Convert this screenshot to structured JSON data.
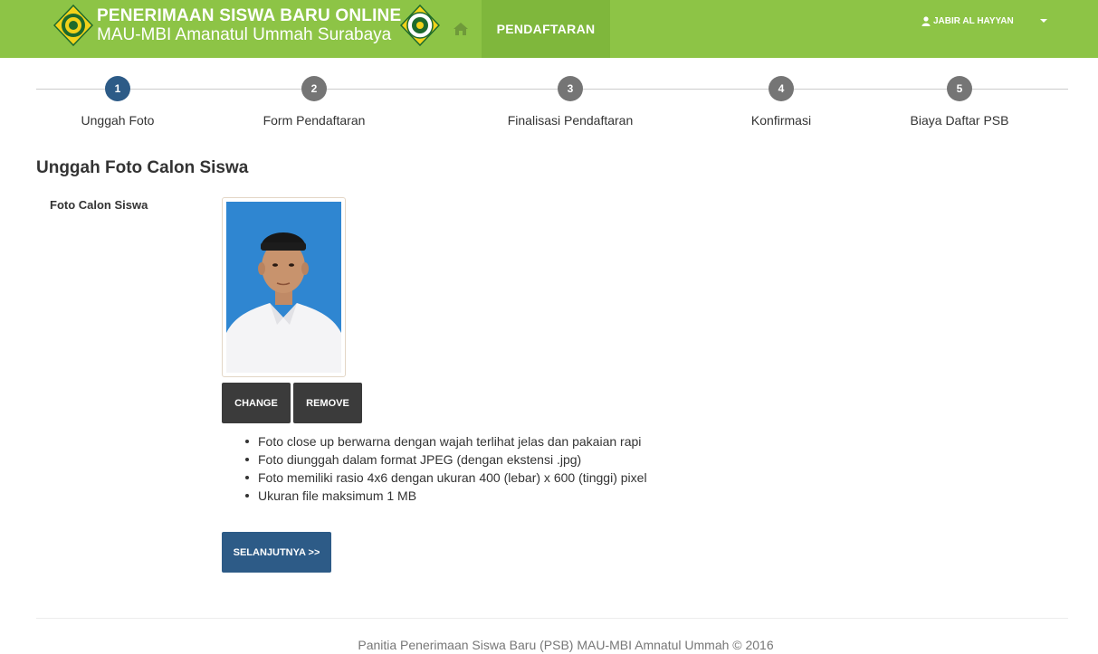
{
  "header": {
    "title": "PENERIMAAN SISWA BARU ONLINE",
    "subtitle": "MAU-MBI Amanatul Ummah Surabaya",
    "home_icon": "home-icon",
    "nav_active": "PENDAFTARAN",
    "user_name": "JABIR AL HAYYAN",
    "colors": {
      "bar": "#8dc446",
      "active": "#7fb73c"
    }
  },
  "wizard": {
    "steps": [
      {
        "number": "1",
        "label": "Unggah Foto",
        "active": true
      },
      {
        "number": "2",
        "label": "Form Pendaftaran",
        "active": false
      },
      {
        "number": "3",
        "label": "Finalisasi Pendaftaran",
        "active": false
      },
      {
        "number": "4",
        "label": "Konfirmasi",
        "active": false
      },
      {
        "number": "5",
        "label": "Biaya Daftar PSB",
        "active": false
      }
    ],
    "colors": {
      "active": "#2d5b87",
      "inactive": "#757575"
    }
  },
  "content": {
    "heading": "Unggah Foto Calon Siswa",
    "field_label": "Foto Calon Siswa",
    "change_button": "CHANGE",
    "remove_button": "REMOVE",
    "notes": [
      "Foto close up berwarna dengan wajah terlihat jelas dan pakaian rapi",
      "Foto diunggah dalam format JPEG (dengan ekstensi .jpg)",
      "Foto memiliki rasio 4x6 dengan ukuran 400 (lebar) x 600 (tinggi) pixel",
      "Ukuran file maksimum 1 MB"
    ],
    "next_button": "SELANJUTNYA >>"
  },
  "footer": {
    "text": "Panitia Penerimaan Siswa Baru (PSB) MAU-MBI Amnatul Ummah © 2016"
  }
}
